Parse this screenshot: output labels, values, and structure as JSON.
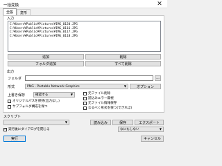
{
  "window": {
    "title": "一括変換",
    "close_glyph": "✕"
  },
  "tabs": [
    {
      "label": "全般"
    },
    {
      "label": "変形"
    }
  ],
  "input_section": {
    "label": "入力",
    "files": [
      "C:¥Users¥Public¥Pictures¥IMG_0120.JPG",
      "C:¥Users¥Public¥Pictures¥IMG_0116.JPG",
      "C:¥Users¥Public¥Pictures¥IMG_0117.JPG",
      "C:¥Users¥Public¥Pictures¥IMG_0118.JPG"
    ],
    "add_label": "追加",
    "delete_label": "削除",
    "add_folder_label": "フォルダ追加",
    "delete_all_label": "すべて削除"
  },
  "output_section": {
    "label": "出力",
    "folder_label": "フォルダ",
    "folder_value": "",
    "browse_label": "...",
    "format_label": "形式",
    "format_value": "PNG - Portable Network Graphics",
    "options_label": "オプション",
    "overwrite_label": "上書き保存",
    "overwrite_value": "確認する",
    "checkbox_keep_subfolders": "サブフォルダ構成を保つ",
    "checkbox_original_path": "オリジナルパスを保持(出力なし)",
    "checkbox_delete_original": "元ファイル削除",
    "checkbox_read_only": "読込みエラー無視",
    "checkbox_keep_date": "元ファイル情報保存",
    "checkbox_repeat": "なるべく形式を保つ(できれば)"
  },
  "script_section": {
    "label": "スクリプト",
    "script_value": "",
    "load_label": "読み込み",
    "save_label": "保存",
    "export_label": "エクスポート"
  },
  "footer": {
    "close_after_label": "実行後にダイアログを閉じる",
    "close_after_checked": true,
    "after_action_value": "なにもしない",
    "run_label": "実行",
    "cancel_label": "キャンセル"
  },
  "colors": {
    "accent_border": "#0078d7",
    "checkmark": "#000000"
  }
}
